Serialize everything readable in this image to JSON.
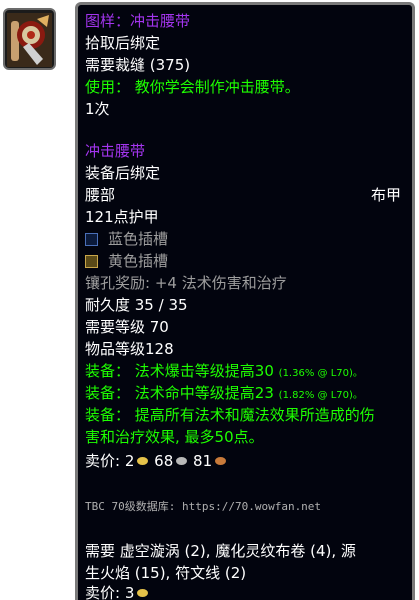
{
  "pattern": {
    "title": "图样：冲击腰带",
    "bind": "拾取后绑定",
    "requires_skill": "需要裁缝 (375)",
    "use_text": "使用： 教你学会制作冲击腰带。",
    "count": "1次"
  },
  "item": {
    "name": "冲击腰带",
    "bind": "装备后绑定",
    "slot": "腰部",
    "type": "布甲",
    "armor": "121点护甲",
    "sockets": [
      {
        "label": "蓝色插槽",
        "color": "#4a6fb8"
      },
      {
        "label": "黄色插槽",
        "color": "#c8a64a"
      }
    ],
    "socket_bonus": "镶孔奖励: +4 法术伤害和治疗",
    "durability": "耐久度 35 / 35",
    "required_level": "需要等级 70",
    "item_level": "物品等级128",
    "equip1_prefix": "装备：",
    "equip1_text": "法术爆击等级提高30",
    "equip1_pct": "(1.36% @ L70)。",
    "equip2_prefix": "装备：",
    "equip2_text": "法术命中等级提高23",
    "equip2_pct": "(1.82% @ L70)。",
    "equip3_line1": "装备： 提高所有法术和魔法效果所造成的伤",
    "equip3_line2": "害和治疗效果, 最多50点。",
    "sell_label": "卖价: ",
    "sell_gold": "2",
    "sell_silver": "68",
    "sell_copper": "81"
  },
  "source_note": "TBC 70级数据库: https://70.wowfan.net",
  "reagents_line1": "需要 虚空漩涡 (2), 魔化灵纹布卷 (4), 源",
  "reagents_line2": "生火焰 (15), 符文线 (2)",
  "pattern_sell_label": "卖价: ",
  "pattern_sell_gold": "3",
  "colors": {
    "epic_purple": "#a335ee",
    "use_green": "#1eff00",
    "background": "#02040e"
  }
}
